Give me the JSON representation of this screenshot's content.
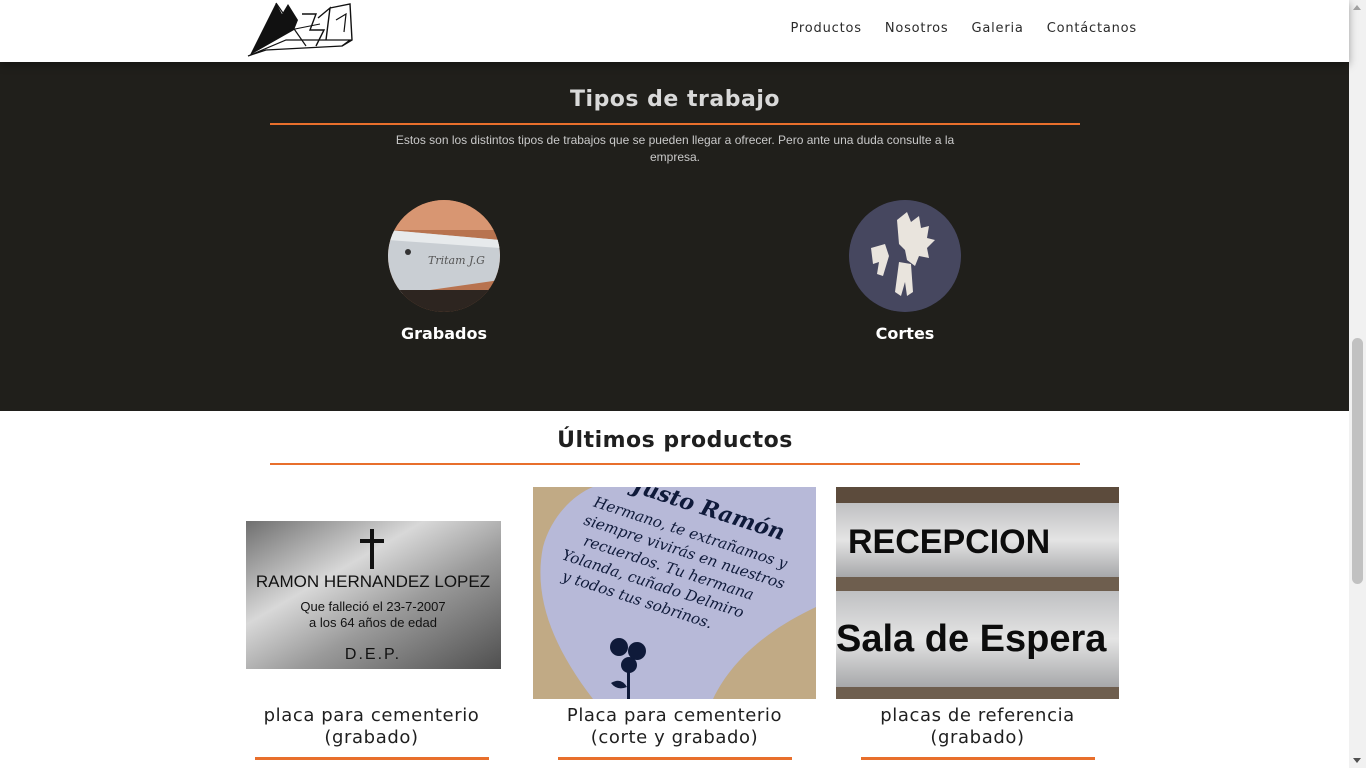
{
  "header": {
    "nav": [
      "Productos",
      "Nosotros",
      "Galeria",
      "Contáctanos"
    ]
  },
  "work_types": {
    "title": "Tipos de trabajo",
    "description": "Estos son los distintos tipos de trabajos que se pueden llegar a ofrecer. Pero ante una duda consulte a la empresa.",
    "items": [
      {
        "label": "Grabados",
        "image_text": "Tritam J.G"
      },
      {
        "label": "Cortes"
      }
    ]
  },
  "latest_products": {
    "title": "Últimos productos",
    "items": [
      {
        "title_line1": "placa para cementerio",
        "title_line2": "(grabado)",
        "plate_name": "RAMON HERNANDEZ LOPEZ",
        "plate_line1": "Que falleció el 23-7-2007",
        "plate_line2": "a los 64 años de edad",
        "plate_line3": "D.E.P."
      },
      {
        "title_line1": "Placa para cementerio",
        "title_line2": "(corte y grabado)",
        "plate_name": "Justo Ramón",
        "plate_lines": [
          "Hermano, te extrañamos y",
          "siempre vivirás en nuestros",
          "recuerdos. Tu hermana",
          "Yolanda, cuñado Delmiro",
          "y todos tus sobrinos."
        ]
      },
      {
        "title_line1": "placas de referencia",
        "title_line2": "(grabado)",
        "plate_top": "RECEPCION",
        "plate_bottom": "Sala de Espera"
      }
    ]
  },
  "colors": {
    "accent": "#e86f2c",
    "dark_bg": "#201f1b"
  }
}
